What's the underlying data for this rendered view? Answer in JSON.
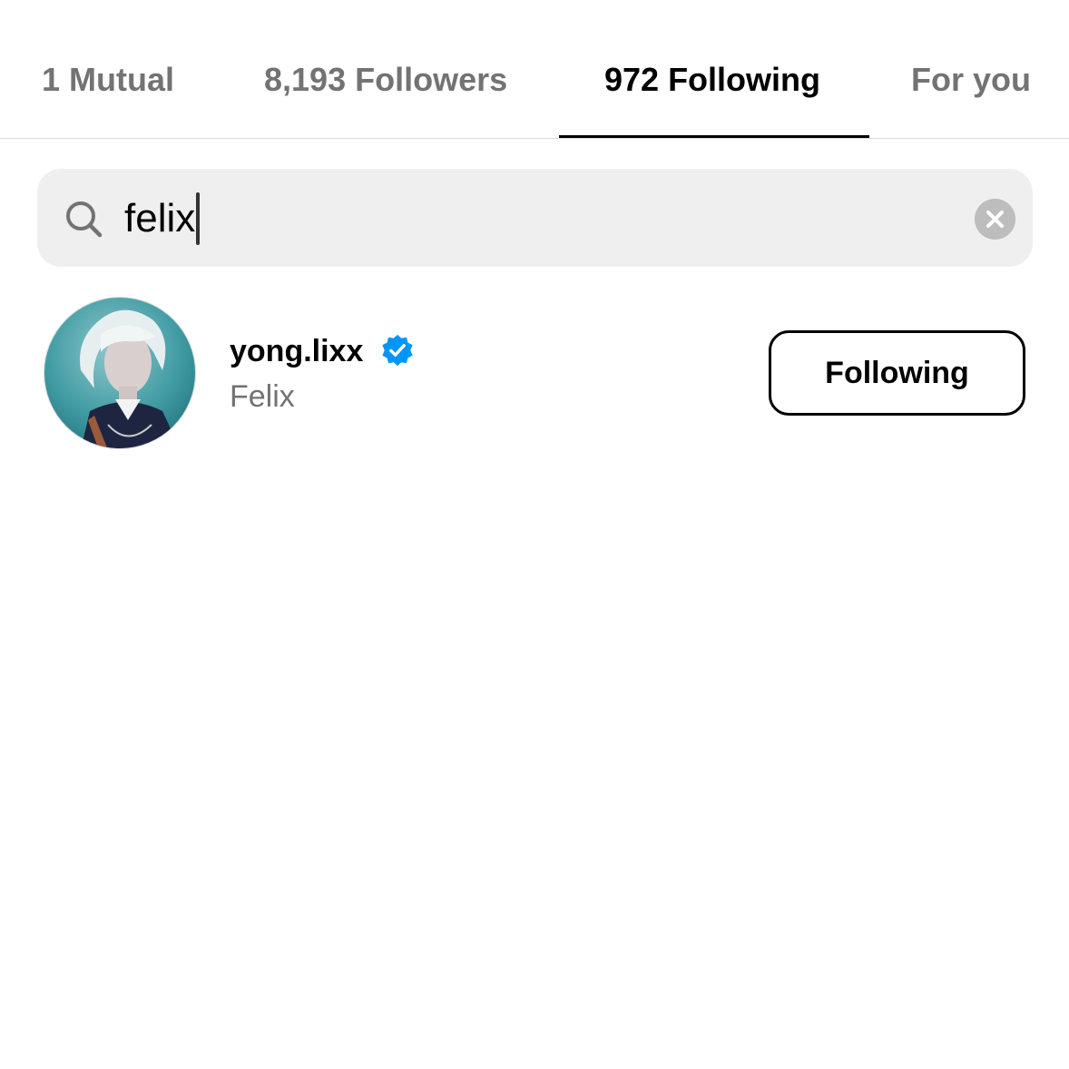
{
  "tabs": {
    "mutual": "1 Mutual",
    "followers": "8,193 Followers",
    "following": "972 Following",
    "for_you": "For you",
    "active": "following"
  },
  "search": {
    "value": "felix",
    "icon": "search-icon",
    "clear_icon": "close-icon"
  },
  "results": [
    {
      "username": "yong.lixx",
      "full_name": "Felix",
      "verified": true,
      "button_label": "Following"
    }
  ],
  "colors": {
    "verified": "#0095f6",
    "secondary_text": "#737373",
    "search_bg": "#efefef"
  }
}
